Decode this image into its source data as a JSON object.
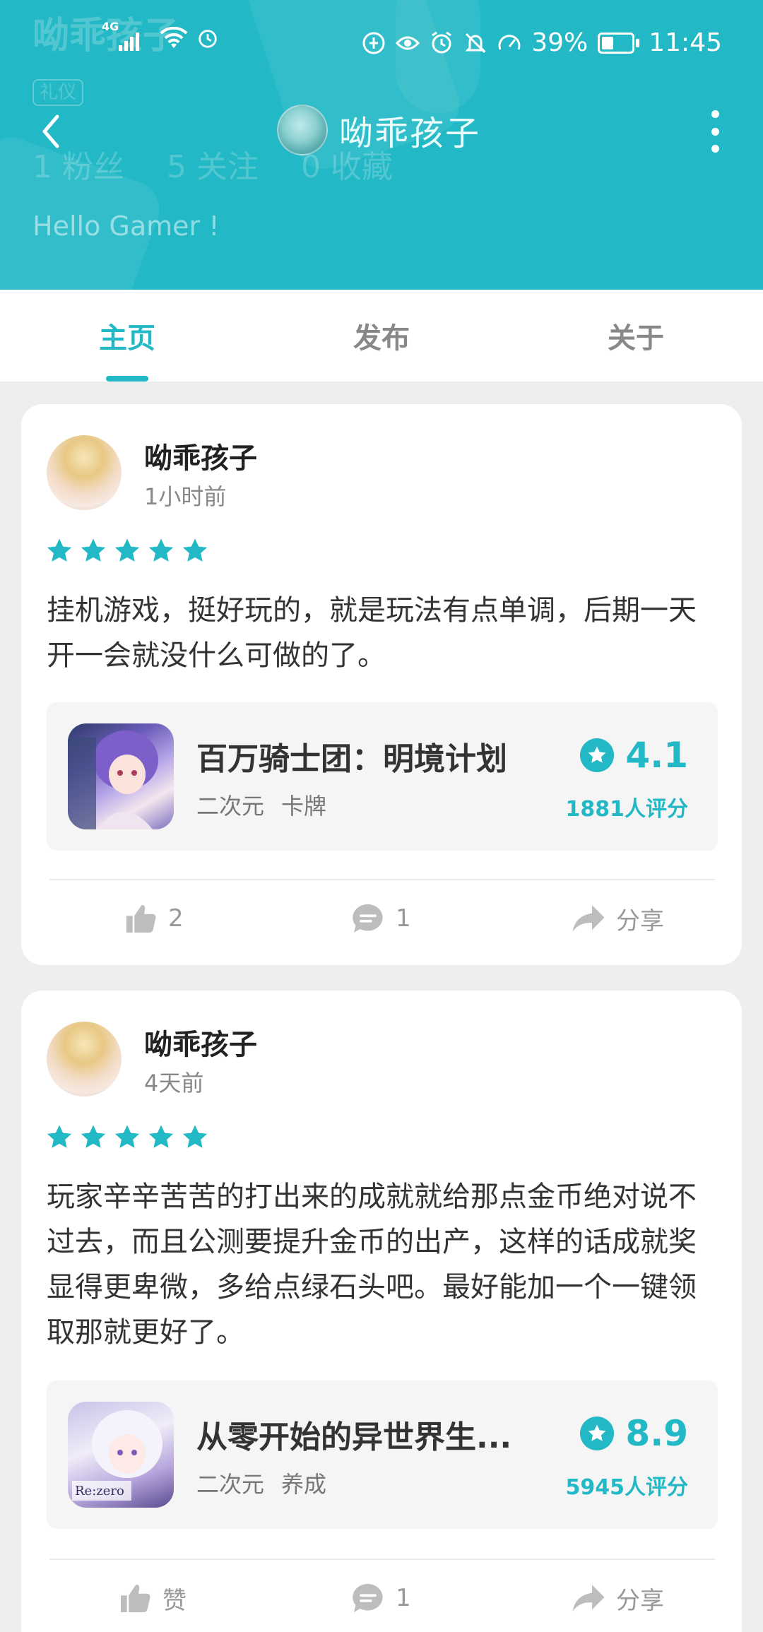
{
  "colors": {
    "accent": "#22b8c5",
    "background": "#eeeeee",
    "card": "#ffffff"
  },
  "status_bar": {
    "network": "4G",
    "battery": "39%",
    "time": "11:45"
  },
  "header": {
    "title": "呦乖孩子",
    "bg_name": "呦乖孩子",
    "bg_tag": "礼仪",
    "bg_stats": [
      "1 粉丝",
      "5 关注",
      "0 收藏"
    ],
    "bg_hello": "Hello Gamer !"
  },
  "tabs": [
    {
      "label": "主页"
    },
    {
      "label": "发布"
    },
    {
      "label": "关于"
    }
  ],
  "posts": [
    {
      "username": "呦乖孩子",
      "time": "1小时前",
      "stars": 5,
      "text": "挂机游戏，挺好玩的，就是玩法有点单调，后期一天开一会就没什么可做的了。",
      "game": {
        "title": "百万骑士团：明境计划",
        "tags": [
          "二次元",
          "卡牌"
        ],
        "rating": "4.1",
        "rating_count": "1881人评分"
      },
      "like": "2",
      "comment": "1",
      "share": "分享"
    },
    {
      "username": "呦乖孩子",
      "time": "4天前",
      "stars": 5,
      "text": "玩家辛辛苦苦的打出来的成就就给那点金币绝对说不过去，而且公测要提升金币的出产，这样的话成就奖显得更卑微，多给点绿石头吧。最好能加一个一键领取那就更好了。",
      "game": {
        "title": "从零开始的异世界生...",
        "tags": [
          "二次元",
          "养成"
        ],
        "rating": "8.9",
        "rating_count": "5945人评分"
      },
      "like": "赞",
      "comment": "1",
      "share": "分享"
    }
  ]
}
